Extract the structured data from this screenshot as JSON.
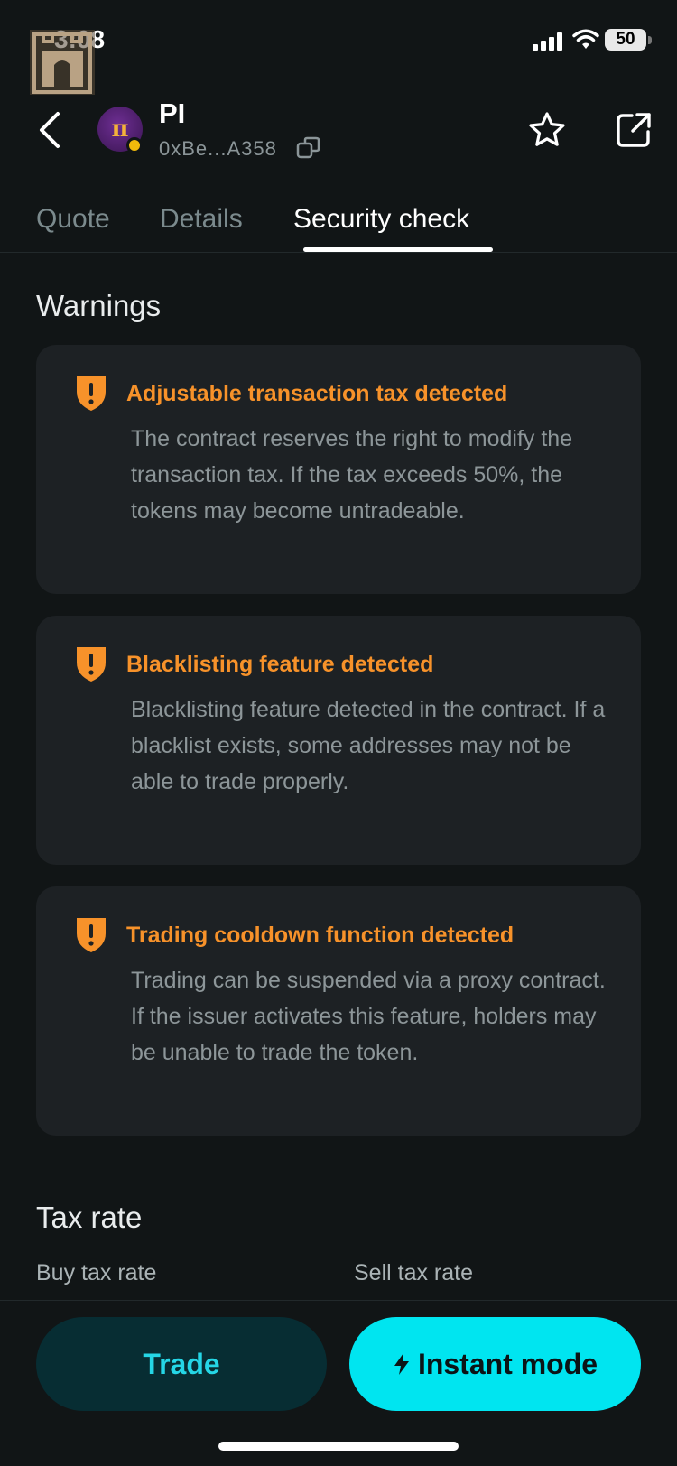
{
  "status_bar": {
    "time": "3:08",
    "battery": "50"
  },
  "header": {
    "token_name": "PI",
    "token_address": "0xBe...A358",
    "logo_glyph": "π"
  },
  "tabs": [
    {
      "label": "Quote",
      "active": false
    },
    {
      "label": "Details",
      "active": false
    },
    {
      "label": "Security check",
      "active": true
    }
  ],
  "warnings": {
    "title": "Warnings",
    "items": [
      {
        "title": "Adjustable transaction tax detected",
        "body": "The contract reserves the right to modify the transaction tax. If the tax exceeds 50%, the tokens may become untradeable."
      },
      {
        "title": "Blacklisting feature detected",
        "body": "Blacklisting feature detected in the contract. If a blacklist exists, some addresses may not be able to trade properly."
      },
      {
        "title": "Trading cooldown function detected",
        "body": "Trading can be suspended via a proxy contract. If the issuer activates this feature, holders may be unable to trade the token."
      }
    ]
  },
  "tax_rate": {
    "title": "Tax rate",
    "buy_label": "Buy tax rate",
    "sell_label": "Sell tax rate"
  },
  "actions": {
    "trade_label": "Trade",
    "instant_label": "Instant mode"
  },
  "colors": {
    "background": "#111516",
    "card": "#1d2124",
    "warning": "#f7922a",
    "accent": "#00e5f0",
    "trade_button": "#072d33"
  },
  "icons": [
    "castle-icon",
    "signal-icon",
    "wifi-icon",
    "back-chevron-icon",
    "copy-icon",
    "star-icon",
    "share-icon",
    "warning-shield-icon",
    "lightning-icon"
  ]
}
